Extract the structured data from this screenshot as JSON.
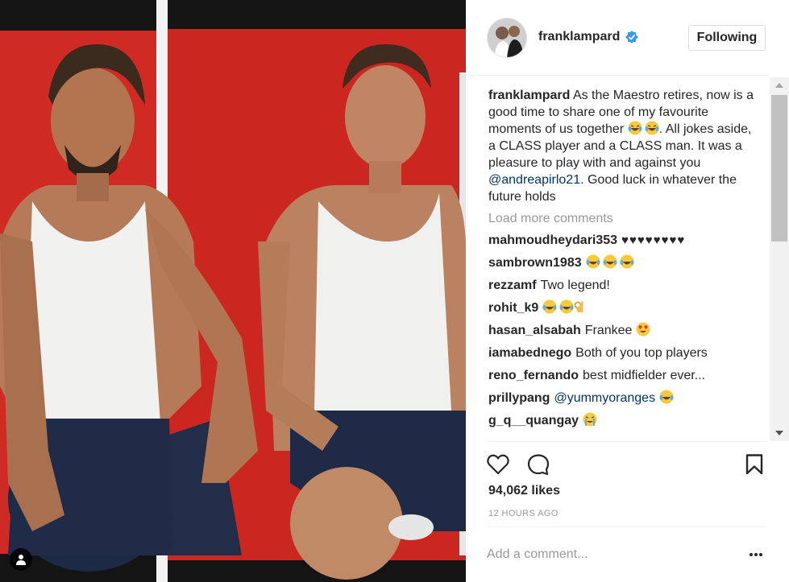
{
  "post": {
    "owner": "franklampard",
    "follow_label": "Following",
    "caption": {
      "username": "franklampard",
      "text_1": "As the Maestro retires, now is a good time to share one of my favourite moments of us together ",
      "text_2": ". All jokes aside, a CLASS player and a CLASS man. It was a pleasure to play with and against you ",
      "mention": "@andreapirlo21",
      "text_3": ". Good luck in whatever the future holds"
    },
    "load_more": "Load more comments",
    "comments": [
      {
        "username": "mahmoudheydari353",
        "text": "",
        "emoji": "hearts"
      },
      {
        "username": "sambrown1983",
        "text": "",
        "emoji": "laugh-x3"
      },
      {
        "username": "rezzamf",
        "text": "Two legend!",
        "emoji": ""
      },
      {
        "username": "rohit_k9",
        "text": "",
        "emoji": "laugh-x2-ok"
      },
      {
        "username": "hasan_alsabah",
        "text": "Frankee ",
        "emoji": "heart-eyes"
      },
      {
        "username": "iamabednego",
        "text": "Both of you top players",
        "emoji": ""
      },
      {
        "username": "reno_fernando",
        "text": "best midfielder ever...",
        "emoji": ""
      },
      {
        "username": "prillypang",
        "mention": "@yummyoranges",
        "text": " ",
        "emoji": "laugh"
      },
      {
        "username": "g_q__quangay",
        "text": "",
        "emoji": "cry-laugh"
      }
    ],
    "hearts_text": "♥♥♥♥♥♥♥♥",
    "likes": "94,062 likes",
    "time": "12 HOURS AGO",
    "add_comment_placeholder": "Add a comment...",
    "more_label": "•••"
  },
  "colors": {
    "accent_blue": "#3897f0",
    "mention": "#003569",
    "muted": "#999999",
    "photo_red": "#cf2a24"
  },
  "icons": [
    "user-tag-icon",
    "verified-badge-icon",
    "heart-icon",
    "comment-icon",
    "bookmark-icon",
    "more-options-icon",
    "scroll-up-icon",
    "scroll-down-icon"
  ]
}
